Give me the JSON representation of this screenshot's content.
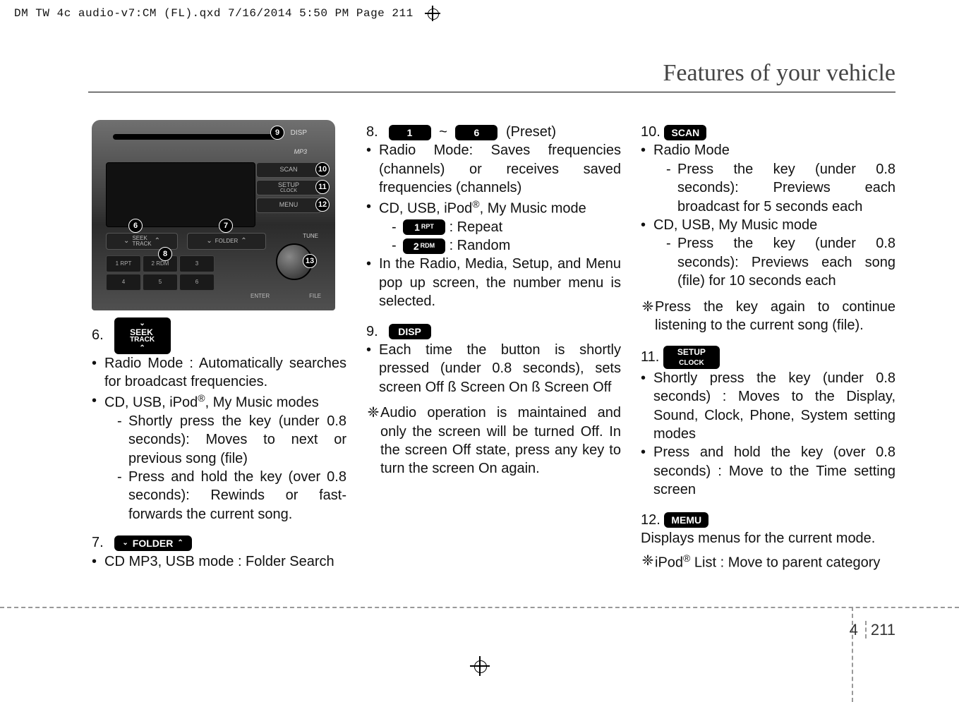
{
  "printmark": "DM TW 4c audio-v7:CM (FL).qxd  7/16/2014  5:50 PM  Page 211",
  "page_title": "Features of your vehicle",
  "page_section": "4",
  "page_number": "211",
  "unit_labels": {
    "disp": "DISP",
    "mp3": "MP3",
    "scan": "SCAN",
    "setup1": "SETUP",
    "setup2": "CLOCK",
    "menu": "MENU",
    "seek1": "SEEK",
    "seek2": "TRACK",
    "folder": "FOLDER",
    "tune": "TUNE",
    "enter": "ENTER",
    "file": "FILE",
    "n1": "1  RPT",
    "n2": "2  RDM",
    "n3": "3",
    "n4": "4",
    "n5": "5",
    "n6": "6"
  },
  "callouts": {
    "c6": "6",
    "c7": "7",
    "c8": "8",
    "c9": "9",
    "c10": "10",
    "c11": "11",
    "c12": "12",
    "c13": "13"
  },
  "col1": {
    "n6": "6.",
    "key6_l1": "SEEK",
    "key6_l2": "TRACK",
    "b6a": "Radio Mode : Automatically searches for broadcast frequencies.",
    "b6b_pre": "CD, USB, iPod",
    "b6b_reg": "®",
    "b6b_post": ", My Music modes",
    "b6b_d1": "Shortly press the key (under 0.8 seconds): Moves to next or previous song (file)",
    "b6b_d2": "Press and hold the key (over 0.8 seconds): Rewinds or fast-forwards the current song.",
    "n7": "7.",
    "key7": "FOLDER",
    "b7": "CD MP3, USB mode : Folder Search"
  },
  "col2": {
    "n8": "8.",
    "key8a": "1",
    "tilde": "~",
    "key8b": "6",
    "preset": "(Preset)",
    "b8a": "Radio Mode: Saves frequencies (channels) or receives saved frequencies (channels)",
    "b8b_pre": "CD, USB, iPod",
    "b8b_reg": "®",
    "b8b_post": ", My Music mode",
    "k_rpt": "1",
    "k_rpt_s": "RPT",
    "rpt": ": Repeat",
    "k_rdm": "2",
    "k_rdm_s": "RDM",
    "rdm": ": Random",
    "b8c": "In the Radio, Media, Setup, and Menu pop up screen, the number menu is selected.",
    "n9": "9.",
    "key9": "DISP",
    "b9": "Each time the button is shortly pressed (under 0.8 seconds), sets screen Off ß Screen On ß Screen Off",
    "note9": "Audio operation is maintained and only the screen will be turned Off. In the screen Off state, press any key to turn the screen On again."
  },
  "col3": {
    "n10": "10.",
    "key10": "SCAN",
    "b10a": "Radio Mode",
    "b10a_d": "Press the key (under 0.8 seconds): Previews each broadcast for 5 seconds each",
    "b10b": "CD, USB, My Music mode",
    "b10b_d": "Press the key (under 0.8 seconds): Previews each song (file) for 10 seconds each",
    "note10": "Press the key again to continue listening to the current song (file).",
    "n11": "11.",
    "key11_l1": "SETUP",
    "key11_l2": "CLOCK",
    "b11a": "Shortly press the key (under 0.8 seconds) : Moves to the Display, Sound, Clock, Phone, System setting modes",
    "b11b": "Press and hold the key (over 0.8 seconds) : Move to the Time setting screen",
    "n12": "12.",
    "key12": "MEMU",
    "t12a": "Displays menus for the current mode.",
    "note12_pre": "iPod",
    "note12_reg": "®",
    "note12_post": " List : Move to parent category"
  },
  "flower": "❈"
}
